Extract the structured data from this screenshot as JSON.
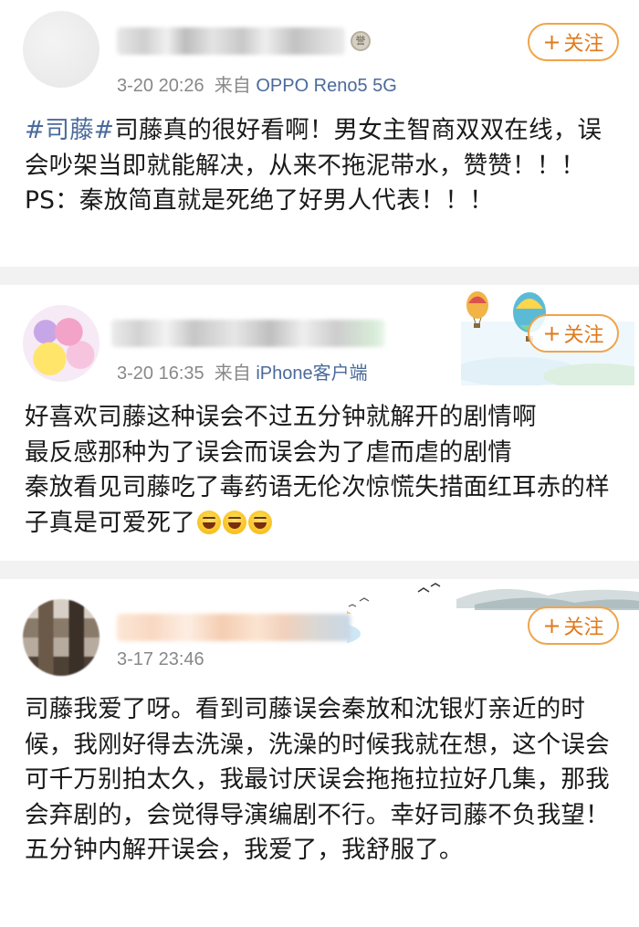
{
  "posts": [
    {
      "time": "3-20 20:26",
      "source_prefix": "来自",
      "source": "OPPO Reno5 5G",
      "follow_label": "关注",
      "follow_icon": "plus-icon",
      "hashtag": "#司藤#",
      "text": "司藤真的很好看啊！男女主智商双双在线，误会吵架当即就能解决，从来不拖泥带水，赞赞！！！PS：秦放简直就是死绝了好男人代表！！！"
    },
    {
      "time": "3-20 16:35",
      "source_prefix": "来自",
      "source": "iPhone客户端",
      "follow_label": "关注",
      "follow_icon": "plus-icon",
      "lines": [
        "好喜欢司藤这种误会不过五分钟就解开的剧情啊",
        "最反感那种为了误会而误会为了虐而虐的剧情",
        "秦放看见司藤吃了毒药语无伦次惊慌失措面红耳赤的样子真是可爱死了"
      ],
      "emoji_name": "laughing-emoji"
    },
    {
      "time": "3-17 23:46",
      "follow_label": "关注",
      "follow_icon": "plus-icon",
      "text": "司藤我爱了呀。看到司藤误会秦放和沈银灯亲近的时候，我刚好得去洗澡，洗澡的时候我就在想，这个误会可千万别拍太久，我最讨厌误会拖拖拉拉好几集，那我会弃剧的，会觉得导演编剧不行。幸好司藤不负我望！五分钟内解开误会，我爱了，我舒服了。"
    }
  ],
  "colors": {
    "link": "#4a6a9c",
    "follow": "#e07a1c",
    "meta": "#888888"
  }
}
